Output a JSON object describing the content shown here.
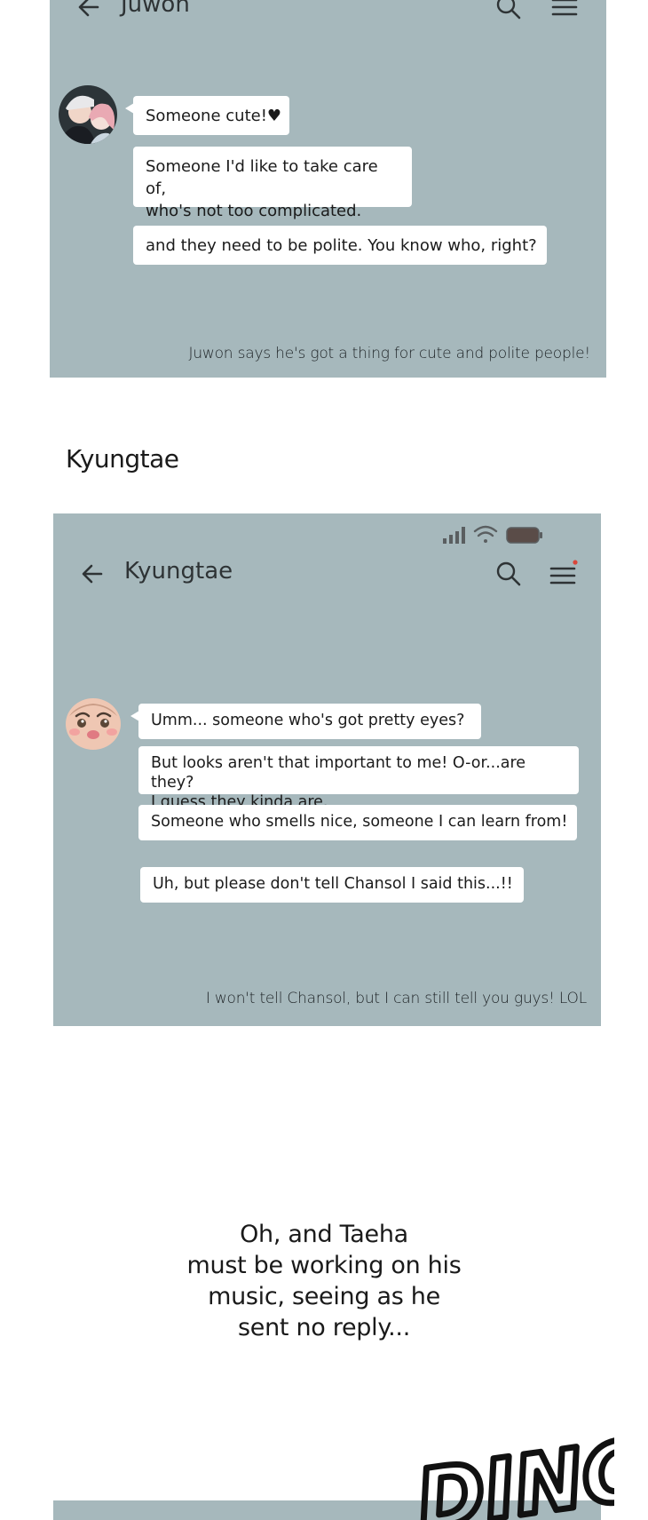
{
  "panel1": {
    "title": "Juwon",
    "messages": [
      "Someone cute!♥",
      "Someone I'd like to take care of,\nwho's not too complicated.",
      "and they need to be polite. You know who, right?"
    ],
    "caption": "Juwon says he's got a thing for cute and polite people!"
  },
  "section_label": "Kyungtae",
  "panel2": {
    "title": "Kyungtae",
    "messages": [
      "Umm... someone who's got pretty eyes?",
      "But looks aren't that important to me! O-or...are they?\nI guess they kinda are.",
      "Someone who smells nice, someone I can learn from!",
      "Uh, but please don't tell Chansol I said this...!!"
    ],
    "caption": "I won't tell Chansol, but I can still tell you guys! LOL"
  },
  "narration": "Oh, and Taeha\nmust be working on his\nmusic, seeing as he\nsent no reply...",
  "sfx": "DING",
  "colors": {
    "chat_background": "#a6b8bc",
    "bubble": "#ffffff",
    "notification_dot": "#d9463a"
  },
  "icons": [
    "back-arrow-icon",
    "search-icon",
    "menu-icon",
    "signal-icon",
    "wifi-icon",
    "battery-icon"
  ]
}
